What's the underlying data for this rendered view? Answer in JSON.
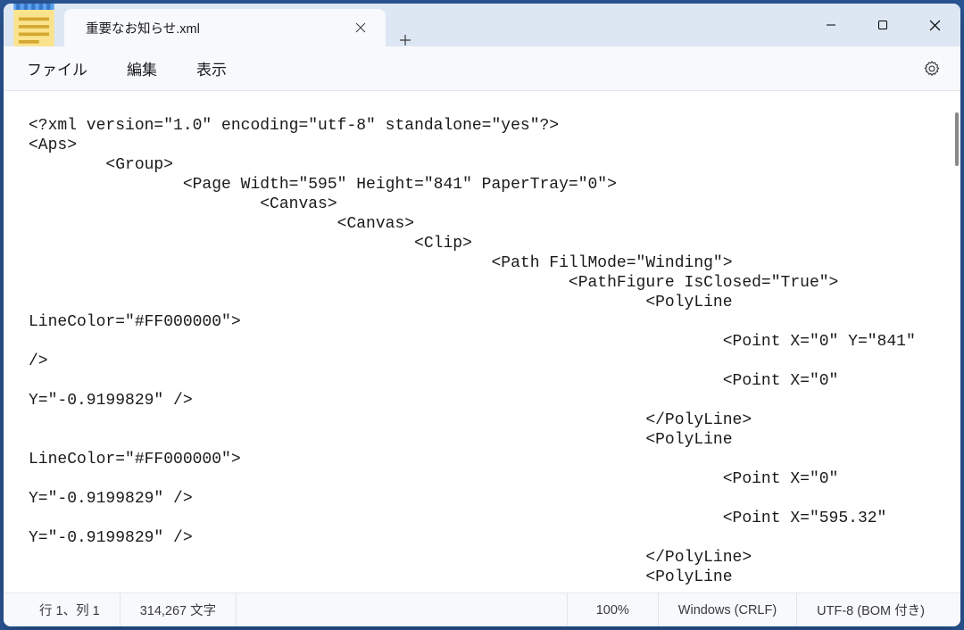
{
  "tab": {
    "title": "重要なお知らせ.xml"
  },
  "menu": {
    "file": "ファイル",
    "edit": "編集",
    "view": "表示"
  },
  "editor": {
    "content": "<?xml version=\"1.0\" encoding=\"utf-8\" standalone=\"yes\"?>\n<Aps>\n        <Group>\n                <Page Width=\"595\" Height=\"841\" PaperTray=\"0\">\n                        <Canvas>\n                                <Canvas>\n                                        <Clip>\n                                                <Path FillMode=\"Winding\">\n                                                        <PathFigure IsClosed=\"True\">\n                                                                <PolyLine \nLineColor=\"#FF000000\">\n                                                                        <Point X=\"0\" Y=\"841\" \n/>\n                                                                        <Point X=\"0\" \nY=\"-0.9199829\" />\n                                                                </PolyLine>\n                                                                <PolyLine \nLineColor=\"#FF000000\">\n                                                                        <Point X=\"0\" \nY=\"-0.9199829\" />\n                                                                        <Point X=\"595.32\" \nY=\"-0.9199829\" />\n                                                                </PolyLine>\n                                                                <PolyLine "
  },
  "status": {
    "position": "行 1、列 1",
    "charcount": "314,267 文字",
    "zoom": "100%",
    "lineending": "Windows (CRLF)",
    "encoding": "UTF-8 (BOM 付き)"
  }
}
